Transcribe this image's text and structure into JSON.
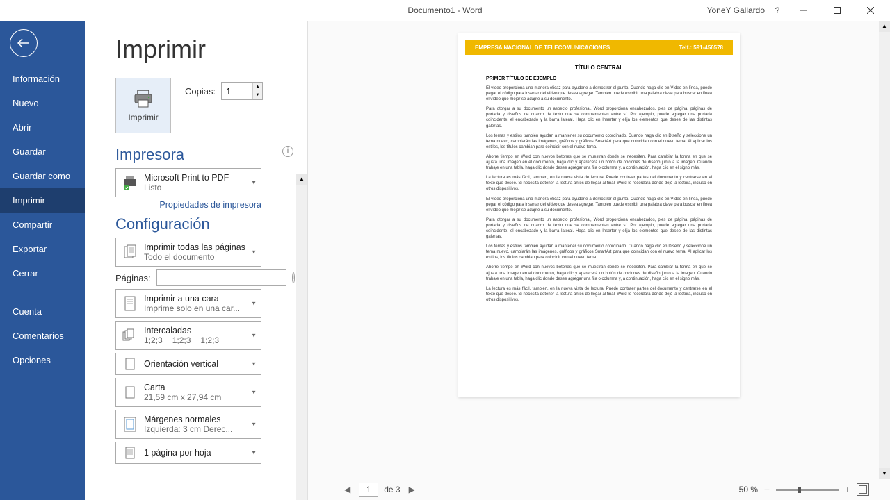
{
  "titlebar": {
    "title": "Documento1  -  Word",
    "user": "YoneY Gallardo"
  },
  "sidebar": {
    "items": [
      {
        "label": "Información"
      },
      {
        "label": "Nuevo"
      },
      {
        "label": "Abrir"
      },
      {
        "label": "Guardar"
      },
      {
        "label": "Guardar como"
      },
      {
        "label": "Imprimir"
      },
      {
        "label": "Compartir"
      },
      {
        "label": "Exportar"
      },
      {
        "label": "Cerrar"
      },
      {
        "label": "Cuenta"
      },
      {
        "label": "Comentarios"
      },
      {
        "label": "Opciones"
      }
    ],
    "active_index": 5
  },
  "print": {
    "heading": "Imprimir",
    "button_label": "Imprimir",
    "copies_label": "Copias:",
    "copies_value": "1",
    "printer_section": "Impresora",
    "printer_name": "Microsoft Print to PDF",
    "printer_status": "Listo",
    "printer_props_link": "Propiedades de impresora",
    "config_section": "Configuración",
    "scope_main": "Imprimir todas las páginas",
    "scope_sub": "Todo el documento",
    "pages_label": "Páginas:",
    "side_main": "Imprimir a una cara",
    "side_sub": "Imprime solo en una car...",
    "collate_main": "Intercaladas",
    "collate_sub1": "1;2;3",
    "collate_sub2": "1;2;3",
    "collate_sub3": "1;2;3",
    "orient_main": "Orientación vertical",
    "paper_main": "Carta",
    "paper_sub": "21,59 cm x 27,94 cm",
    "margins_main": "Márgenes normales",
    "margins_sub": "Izquierda:   3 cm     Derec...",
    "ppp_main": "1 página por hoja"
  },
  "preview": {
    "header_company": "EMPRESA NACIONAL DE TELECOMUNICACIONES",
    "header_phone": "Telf.: 591-456578",
    "title": "TÍTULO CENTRAL",
    "subtitle": "PRIMER TÍTULO DE EJEMPLO",
    "p1": "El vídeo proporciona una manera eficaz para ayudarle a demostrar el punto. Cuando haga clic en Vídeo en línea, puede pegar el código para insertar del vídeo que desea agregar. También puede escribir una palabra clave para buscar en línea el vídeo que mejor se adapte a su documento.",
    "p2": "Para otorgar a su documento un aspecto profesional, Word proporciona encabezados, pies de página, páginas de portada y diseños de cuadro de texto que se complementan entre sí. Por ejemplo, puede agregar una portada coincidente, el encabezado y la barra lateral. Haga clic en Insertar y elija los elementos que desee de las distintas galerías.",
    "p3": "Los temas y estilos también ayudan a mantener su documento coordinado. Cuando haga clic en Diseño y seleccione un tema nuevo, cambiarán las imágenes, gráficos y gráficos SmartArt para que coincidan con el nuevo tema. Al aplicar los estilos, los títulos cambian para coincidir con el nuevo tema.",
    "p4": "Ahorre tiempo en Word con nuevos botones que se muestran donde se necesiten. Para cambiar la forma en que se ajusta una imagen en el documento, haga clic y aparecerá un botón de opciones de diseño junto a la imagen. Cuando trabaje en una tabla, haga clic donde desee agregar una fila o columna y, a continuación, haga clic en el signo más.",
    "p5": "La lectura es más fácil, también, en la nueva vista de lectura. Puede contraer partes del documento y centrarse en el texto que desee. Si necesita detener la lectura antes de llegar al final, Word le recordará dónde dejó la lectura, incluso en otros dispositivos.",
    "footer_page": "1",
    "footer_of": "de 3",
    "zoom": "50 %"
  }
}
